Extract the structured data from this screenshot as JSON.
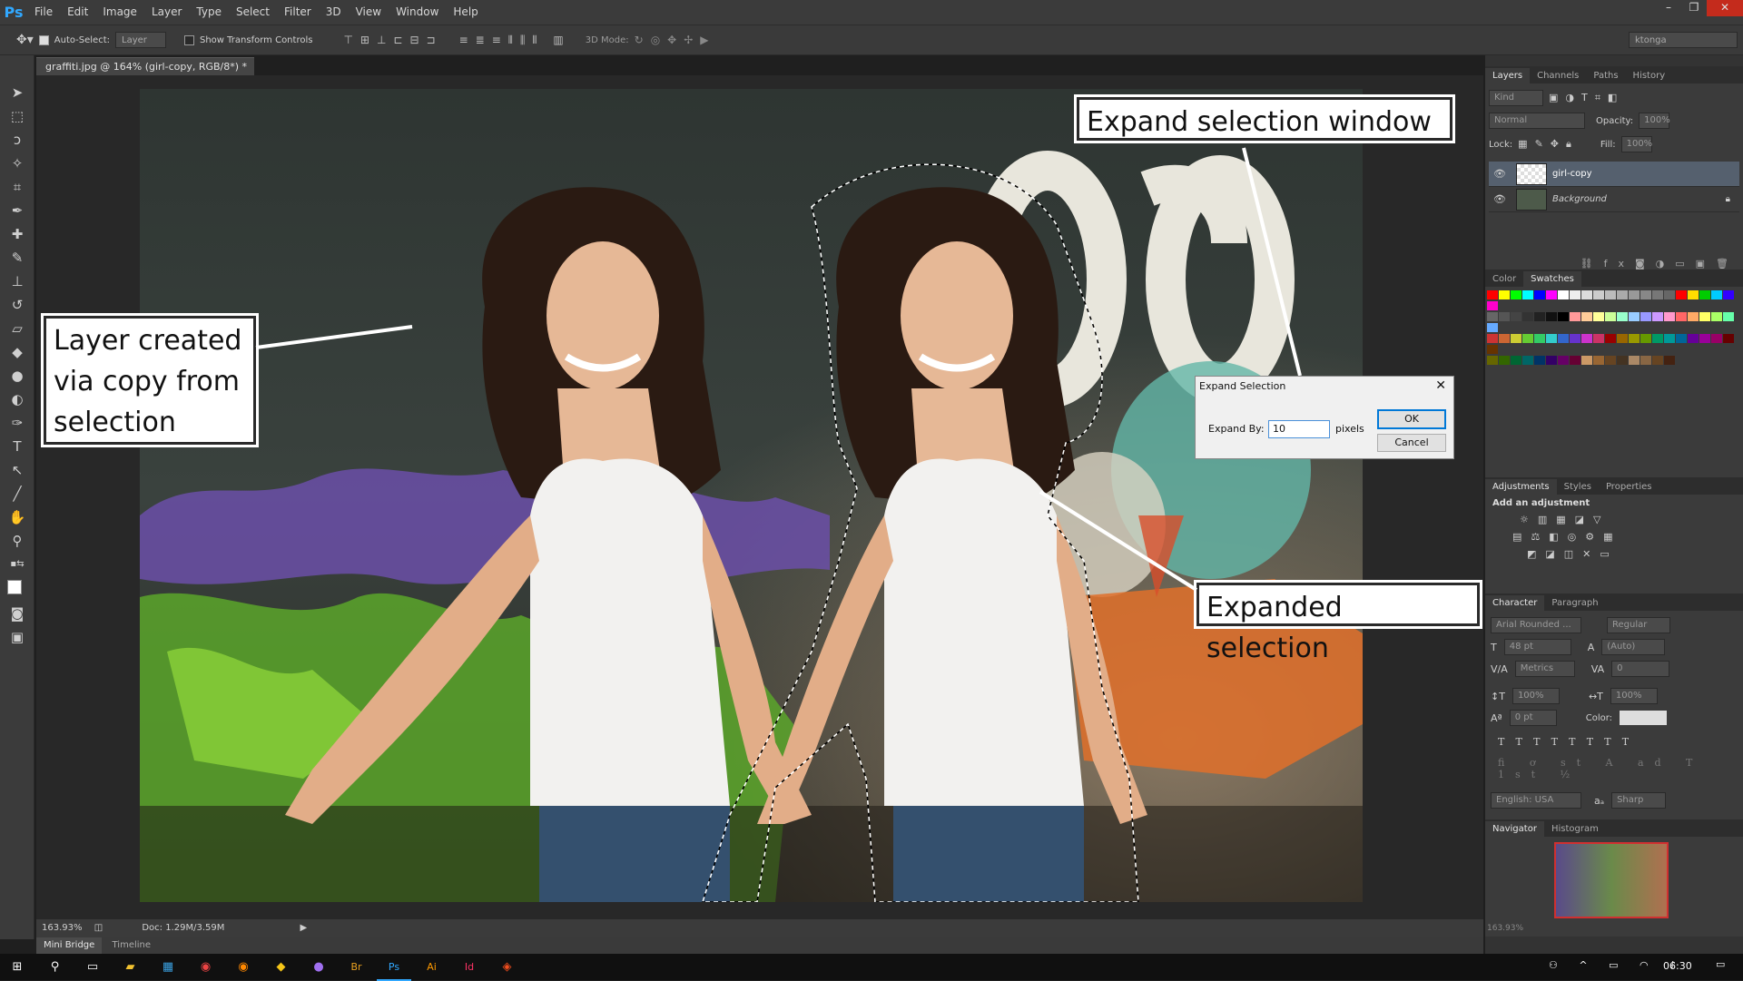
{
  "app": {
    "logo": "Ps"
  },
  "menu": [
    "File",
    "Edit",
    "Image",
    "Layer",
    "Type",
    "Select",
    "Filter",
    "3D",
    "View",
    "Window",
    "Help"
  ],
  "window_controls": {
    "minimize": "–",
    "restore": "❐",
    "close": "✕"
  },
  "options_bar": {
    "auto_select_label": "Auto-Select:",
    "auto_select_target": "Layer",
    "show_transform_label": "Show Transform Controls",
    "mode_3d_label": "3D Mode:",
    "workspace": "ktonga"
  },
  "document": {
    "tab_title": "graffiti.jpg @ 164% (girl-copy, RGB/8*) *",
    "tab_close": "×",
    "zoom": "163.93%",
    "doc_size": "Doc: 1.29M/3.59M"
  },
  "bottom_tabs": [
    "Mini Bridge",
    "Timeline"
  ],
  "layers_panel": {
    "tabs": [
      "Layers",
      "Channels",
      "Paths",
      "History"
    ],
    "kind_label": "Kind",
    "blend_mode": "Normal",
    "opacity_label": "Opacity:",
    "opacity_value": "100%",
    "lock_label": "Lock:",
    "fill_label": "Fill:",
    "fill_value": "100%",
    "layers": [
      {
        "name": "girl-copy",
        "selected": true
      },
      {
        "name": "Background",
        "selected": false
      }
    ]
  },
  "color_panel": {
    "tabs": [
      "Color",
      "Swatches"
    ]
  },
  "adjustments_panel": {
    "tabs": [
      "Adjustments",
      "Styles",
      "Properties"
    ],
    "heading": "Add an adjustment"
  },
  "character_panel": {
    "tabs": [
      "Character",
      "Paragraph"
    ],
    "font_family": "Arial Rounded ...",
    "font_style": "Regular",
    "font_size": "48 pt",
    "leading": "(Auto)",
    "kerning": "Metrics",
    "tracking": "0",
    "vscale": "100%",
    "hscale": "100%",
    "baseline": "0 pt",
    "color_label": "Color:",
    "language": "English: USA",
    "antialias_label": "aₐ",
    "antialias": "Sharp"
  },
  "navigator_panel": {
    "tabs": [
      "Navigator",
      "Histogram"
    ],
    "zoom": "163.93%"
  },
  "expand_dialog": {
    "title": "Expand Selection",
    "label": "Expand By:",
    "value": "10",
    "unit": "pixels",
    "ok": "OK",
    "cancel": "Cancel"
  },
  "callouts": {
    "layer_created": [
      "Layer created",
      "via copy from",
      "selection"
    ],
    "expand_window": "Expand selection window",
    "expanded_selection": "Expanded selection"
  },
  "taskbar": {
    "time": "06:30"
  },
  "colors": {
    "accent": "#31a8ff",
    "panel": "#3b3b3b",
    "canvas": "#282828"
  }
}
